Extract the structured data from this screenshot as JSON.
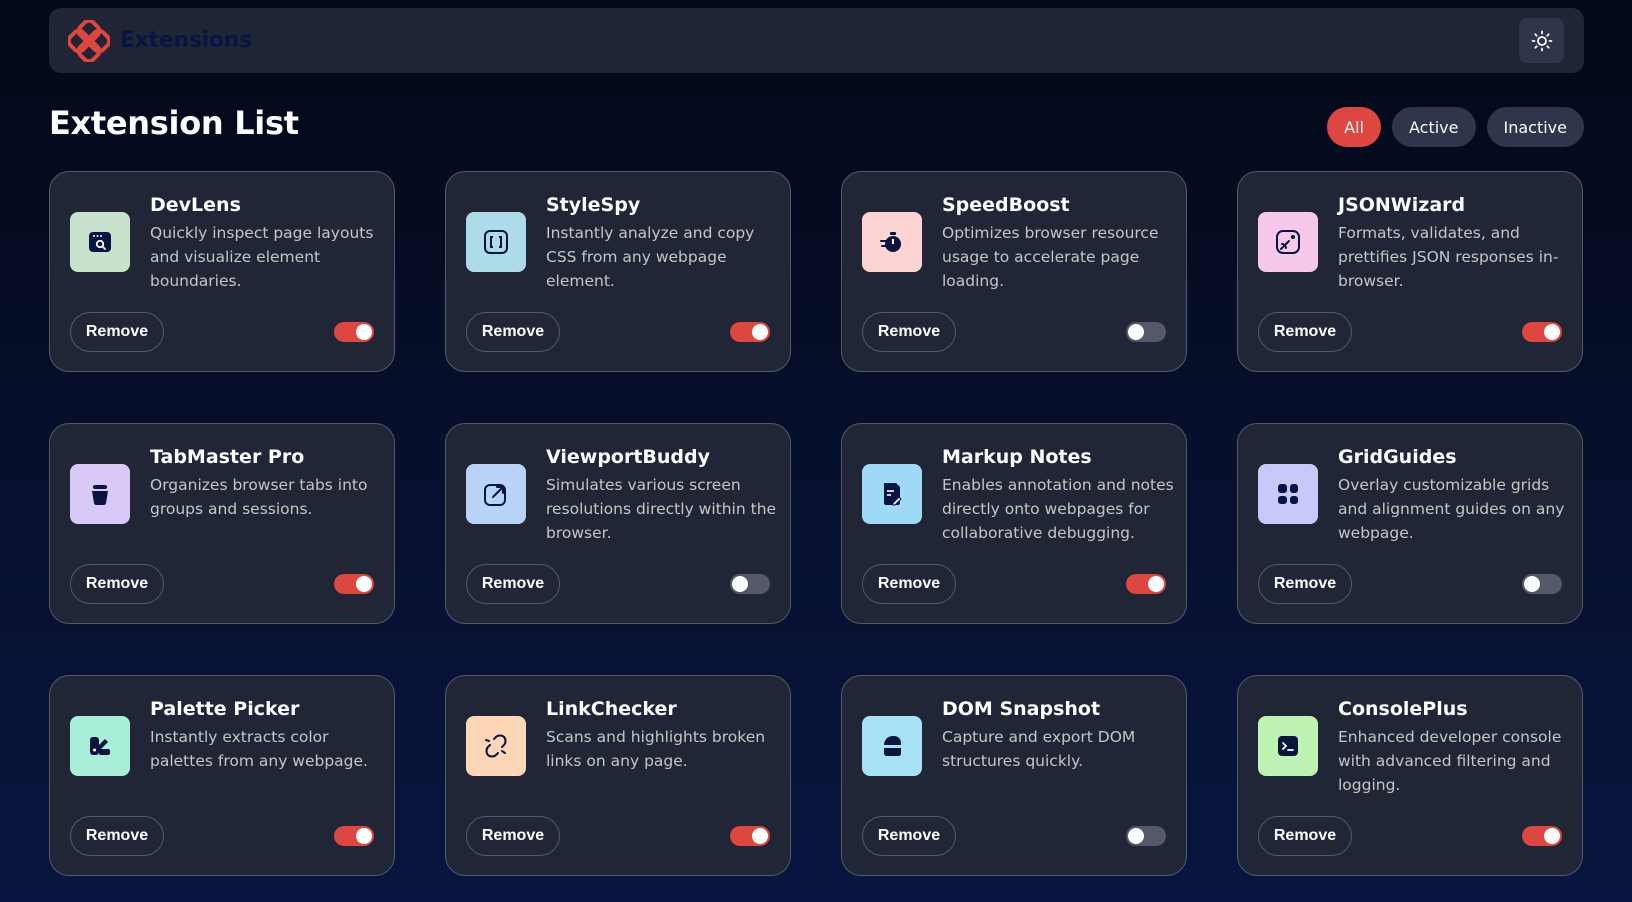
{
  "header": {
    "brand": "Extensions",
    "theme_toggle_icon": "sun-icon"
  },
  "page": {
    "title": "Extension List"
  },
  "filters": [
    {
      "label": "All",
      "active": true
    },
    {
      "label": "Active",
      "active": false
    },
    {
      "label": "Inactive",
      "active": false
    }
  ],
  "colors": {
    "accent": "#de473f",
    "card_bg": "#212636",
    "surface": "#2f354b",
    "border": "#545969"
  },
  "remove_label": "Remove",
  "extensions": [
    {
      "name": "DevLens",
      "description": "Quickly inspect page layouts and visualize element boundaries.",
      "enabled": true,
      "icon": "browser-search-icon",
      "icon_bg": "#c7e3cd"
    },
    {
      "name": "StyleSpy",
      "description": "Instantly analyze and copy CSS from any webpage element.",
      "enabled": true,
      "icon": "brackets-icon",
      "icon_bg": "#aedbe8"
    },
    {
      "name": "SpeedBoost",
      "description": "Optimizes browser resource usage to accelerate page loading.",
      "enabled": false,
      "icon": "stopwatch-icon",
      "icon_bg": "#fdd4d4"
    },
    {
      "name": "JSONWizard",
      "description": "Formats, validates, and prettifies JSON responses in-browser.",
      "enabled": true,
      "icon": "image-paint-icon",
      "icon_bg": "#f6c8ea"
    },
    {
      "name": "TabMaster Pro",
      "description": "Organizes browser tabs into groups and sessions.",
      "enabled": true,
      "icon": "jar-icon",
      "icon_bg": "#d9c9f7"
    },
    {
      "name": "ViewportBuddy",
      "description": "Simulates various screen resolutions directly within the browser.",
      "enabled": false,
      "icon": "expand-arrow-icon",
      "icon_bg": "#b9d3f7"
    },
    {
      "name": "Markup Notes",
      "description": "Enables annotation and notes directly onto webpages for collaborative debugging.",
      "enabled": true,
      "icon": "note-edit-icon",
      "icon_bg": "#9fd9f5"
    },
    {
      "name": "GridGuides",
      "description": "Overlay customizable grids and alignment guides on any webpage.",
      "enabled": false,
      "icon": "grid-icon",
      "icon_bg": "#c8c8fb"
    },
    {
      "name": "Palette Picker",
      "description": "Instantly extracts color palettes from any webpage.",
      "enabled": true,
      "icon": "palette-icon",
      "icon_bg": "#a9eed9"
    },
    {
      "name": "LinkChecker",
      "description": "Scans and highlights broken links on any page.",
      "enabled": true,
      "icon": "broken-link-icon",
      "icon_bg": "#fcd6b5"
    },
    {
      "name": "DOM Snapshot",
      "description": "Capture and export DOM structures quickly.",
      "enabled": false,
      "icon": "capture-icon",
      "icon_bg": "#a7e1f5"
    },
    {
      "name": "ConsolePlus",
      "description": "Enhanced developer console with advanced filtering and logging.",
      "enabled": true,
      "icon": "terminal-icon",
      "icon_bg": "#bff3b3"
    }
  ]
}
